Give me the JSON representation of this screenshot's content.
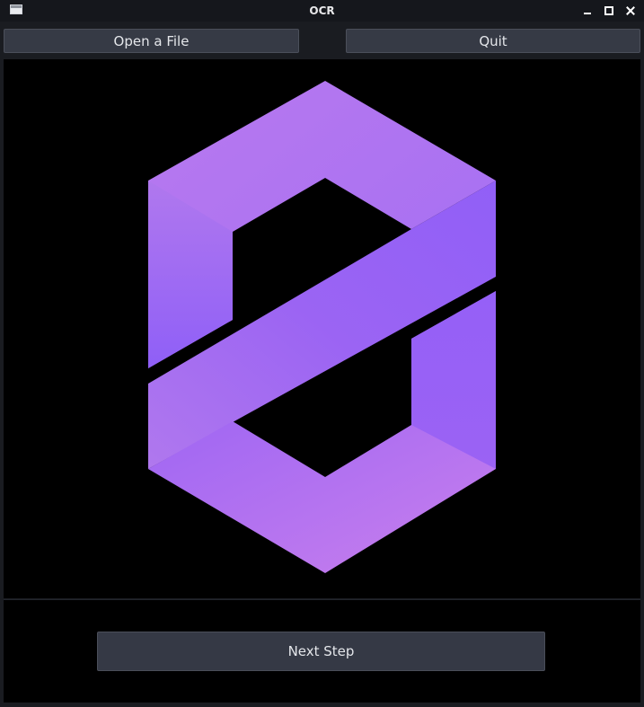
{
  "window": {
    "title": "OCR",
    "controls": [
      "minimize-icon",
      "maximize-icon",
      "close-icon"
    ]
  },
  "toolbar": {
    "open_label": "Open a File",
    "quit_label": "Quit"
  },
  "preview": {
    "image_description_icon": "hexagon-s-logo",
    "colors": {
      "purple_light": "#bd79ef",
      "purple_mid": "#a56cf2",
      "purple_deep": "#8d5cf6"
    }
  },
  "footer": {
    "next_label": "Next Step"
  }
}
